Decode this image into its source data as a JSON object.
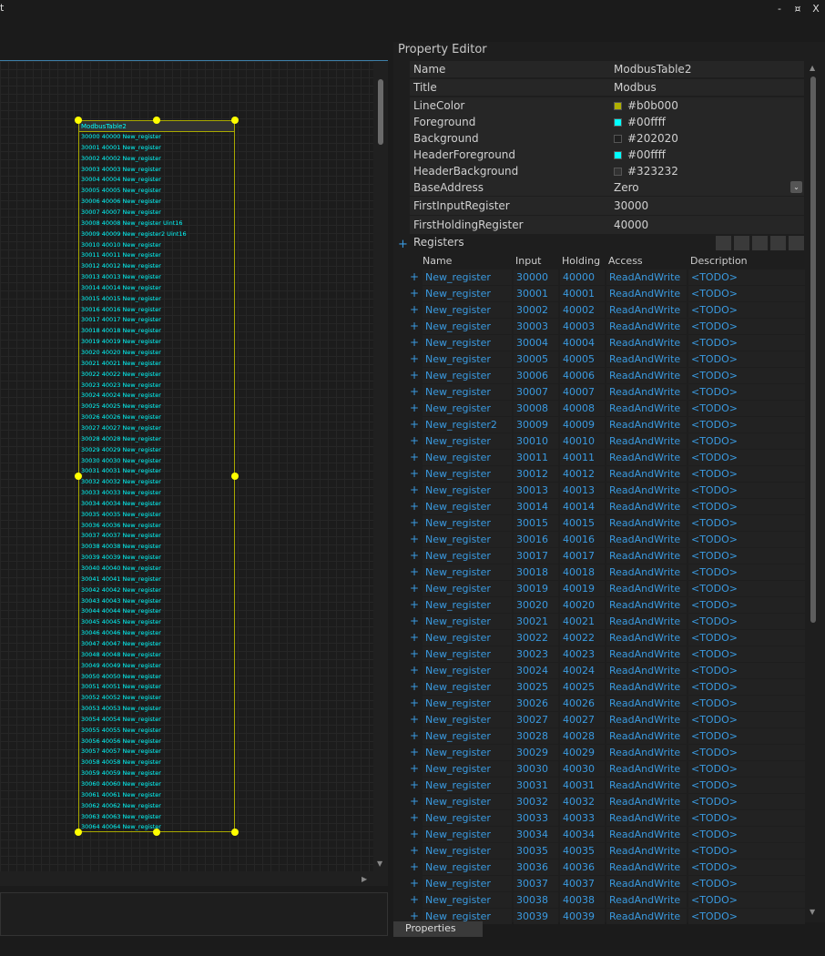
{
  "window": {
    "title": "t",
    "btn_min": "-",
    "btn_restore": "¤",
    "btn_close": "X"
  },
  "designer": {
    "table_title": "ModbusTable2",
    "rows": [
      "30000 40000 New_register",
      "30001 40001 New_register",
      "30002 40002 New_register",
      "30003 40003 New_register",
      "30004 40004 New_register",
      "30005 40005 New_register",
      "30006 40006 New_register",
      "30007 40007 New_register",
      "30008 40008 New_register Uint16",
      "30009 40009 New_register2 Uint16",
      "30010 40010 New_register",
      "30011 40011 New_register",
      "30012 40012 New_register",
      "30013 40013 New_register",
      "30014 40014 New_register",
      "30015 40015 New_register",
      "30016 40016 New_register",
      "30017 40017 New_register",
      "30018 40018 New_register",
      "30019 40019 New_register",
      "30020 40020 New_register",
      "30021 40021 New_register",
      "30022 40022 New_register",
      "30023 40023 New_register",
      "30024 40024 New_register",
      "30025 40025 New_register",
      "30026 40026 New_register",
      "30027 40027 New_register",
      "30028 40028 New_register",
      "30029 40029 New_register",
      "30030 40030 New_register",
      "30031 40031 New_register",
      "30032 40032 New_register",
      "30033 40033 New_register",
      "30034 40034 New_register",
      "30035 40035 New_register",
      "30036 40036 New_register",
      "30037 40037 New_register",
      "30038 40038 New_register",
      "30039 40039 New_register",
      "30040 40040 New_register",
      "30041 40041 New_register",
      "30042 40042 New_register",
      "30043 40043 New_register",
      "30044 40044 New_register",
      "30045 40045 New_register",
      "30046 40046 New_register",
      "30047 40047 New_register",
      "30048 40048 New_register",
      "30049 40049 New_register",
      "30050 40050 New_register",
      "30051 40051 New_register",
      "30052 40052 New_register",
      "30053 40053 New_register",
      "30054 40054 New_register",
      "30055 40055 New_register",
      "30056 40056 New_register",
      "30057 40057 New_register",
      "30058 40058 New_register",
      "30059 40059 New_register",
      "30060 40060 New_register",
      "30061 40061 New_register",
      "30062 40062 New_register",
      "30063 40063 New_register",
      "30064 40064 New_register"
    ]
  },
  "property_editor": {
    "title": "Property Editor",
    "properties": [
      {
        "name": "Name",
        "value": "ModbusTable2"
      },
      {
        "name": "Title",
        "value": "Modbus"
      },
      {
        "name": "LineColor",
        "value": "#b0b000",
        "swatch": "#b0b000"
      },
      {
        "name": "Foreground",
        "value": "#00ffff",
        "swatch": "#00ffff"
      },
      {
        "name": "Background",
        "value": "#202020",
        "swatch": "#202020"
      },
      {
        "name": "HeaderForeground",
        "value": "#00ffff",
        "swatch": "#00ffff"
      },
      {
        "name": "HeaderBackground",
        "value": "#323232",
        "swatch": "#323232"
      },
      {
        "name": "BaseAddress",
        "value": "Zero"
      },
      {
        "name": "FirstInputRegister",
        "value": "30000"
      },
      {
        "name": "FirstHoldingRegister",
        "value": "40000"
      }
    ],
    "registers": {
      "label": "Registers",
      "columns": [
        "Name",
        "Input",
        "Holding",
        "Access",
        "Description"
      ],
      "rows": [
        [
          "New_register",
          "30000",
          "40000",
          "ReadAndWrite",
          "<TODO>"
        ],
        [
          "New_register",
          "30001",
          "40001",
          "ReadAndWrite",
          "<TODO>"
        ],
        [
          "New_register",
          "30002",
          "40002",
          "ReadAndWrite",
          "<TODO>"
        ],
        [
          "New_register",
          "30003",
          "40003",
          "ReadAndWrite",
          "<TODO>"
        ],
        [
          "New_register",
          "30004",
          "40004",
          "ReadAndWrite",
          "<TODO>"
        ],
        [
          "New_register",
          "30005",
          "40005",
          "ReadAndWrite",
          "<TODO>"
        ],
        [
          "New_register",
          "30006",
          "40006",
          "ReadAndWrite",
          "<TODO>"
        ],
        [
          "New_register",
          "30007",
          "40007",
          "ReadAndWrite",
          "<TODO>"
        ],
        [
          "New_register",
          "30008",
          "40008",
          "ReadAndWrite",
          "<TODO>"
        ],
        [
          "New_register2",
          "30009",
          "40009",
          "ReadAndWrite",
          "<TODO>"
        ],
        [
          "New_register",
          "30010",
          "40010",
          "ReadAndWrite",
          "<TODO>"
        ],
        [
          "New_register",
          "30011",
          "40011",
          "ReadAndWrite",
          "<TODO>"
        ],
        [
          "New_register",
          "30012",
          "40012",
          "ReadAndWrite",
          "<TODO>"
        ],
        [
          "New_register",
          "30013",
          "40013",
          "ReadAndWrite",
          "<TODO>"
        ],
        [
          "New_register",
          "30014",
          "40014",
          "ReadAndWrite",
          "<TODO>"
        ],
        [
          "New_register",
          "30015",
          "40015",
          "ReadAndWrite",
          "<TODO>"
        ],
        [
          "New_register",
          "30016",
          "40016",
          "ReadAndWrite",
          "<TODO>"
        ],
        [
          "New_register",
          "30017",
          "40017",
          "ReadAndWrite",
          "<TODO>"
        ],
        [
          "New_register",
          "30018",
          "40018",
          "ReadAndWrite",
          "<TODO>"
        ],
        [
          "New_register",
          "30019",
          "40019",
          "ReadAndWrite",
          "<TODO>"
        ],
        [
          "New_register",
          "30020",
          "40020",
          "ReadAndWrite",
          "<TODO>"
        ],
        [
          "New_register",
          "30021",
          "40021",
          "ReadAndWrite",
          "<TODO>"
        ],
        [
          "New_register",
          "30022",
          "40022",
          "ReadAndWrite",
          "<TODO>"
        ],
        [
          "New_register",
          "30023",
          "40023",
          "ReadAndWrite",
          "<TODO>"
        ],
        [
          "New_register",
          "30024",
          "40024",
          "ReadAndWrite",
          "<TODO>"
        ],
        [
          "New_register",
          "30025",
          "40025",
          "ReadAndWrite",
          "<TODO>"
        ],
        [
          "New_register",
          "30026",
          "40026",
          "ReadAndWrite",
          "<TODO>"
        ],
        [
          "New_register",
          "30027",
          "40027",
          "ReadAndWrite",
          "<TODO>"
        ],
        [
          "New_register",
          "30028",
          "40028",
          "ReadAndWrite",
          "<TODO>"
        ],
        [
          "New_register",
          "30029",
          "40029",
          "ReadAndWrite",
          "<TODO>"
        ],
        [
          "New_register",
          "30030",
          "40030",
          "ReadAndWrite",
          "<TODO>"
        ],
        [
          "New_register",
          "30031",
          "40031",
          "ReadAndWrite",
          "<TODO>"
        ],
        [
          "New_register",
          "30032",
          "40032",
          "ReadAndWrite",
          "<TODO>"
        ],
        [
          "New_register",
          "30033",
          "40033",
          "ReadAndWrite",
          "<TODO>"
        ],
        [
          "New_register",
          "30034",
          "40034",
          "ReadAndWrite",
          "<TODO>"
        ],
        [
          "New_register",
          "30035",
          "40035",
          "ReadAndWrite",
          "<TODO>"
        ],
        [
          "New_register",
          "30036",
          "40036",
          "ReadAndWrite",
          "<TODO>"
        ],
        [
          "New_register",
          "30037",
          "40037",
          "ReadAndWrite",
          "<TODO>"
        ],
        [
          "New_register",
          "30038",
          "40038",
          "ReadAndWrite",
          "<TODO>"
        ],
        [
          "New_register",
          "30039",
          "40039",
          "ReadAndWrite",
          "<TODO>"
        ]
      ]
    },
    "tab_label": "Properties"
  },
  "colors": {
    "accent": "#3a9ae0",
    "table_fg": "#00ffff",
    "table_line": "#b0b000",
    "handle": "#ffff00"
  }
}
